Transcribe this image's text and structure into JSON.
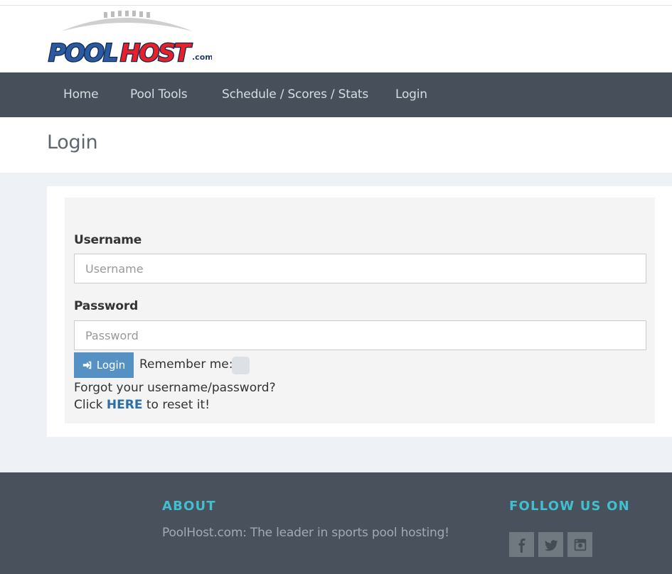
{
  "brand": {
    "logo_text_left": "POOL",
    "logo_text_right": "HOST",
    "logo_suffix": ".com",
    "colors": {
      "navy": "#1f3b6e",
      "red": "#e8202a",
      "gray_ball": "#c8c8c8"
    }
  },
  "nav": {
    "items": [
      {
        "label": "Home"
      },
      {
        "label": "Pool Tools"
      },
      {
        "label": "Schedule / Scores / Stats"
      },
      {
        "label": "Login"
      }
    ]
  },
  "page": {
    "title": "Login"
  },
  "form": {
    "username_label": "Username",
    "username_placeholder": "Username",
    "username_value": "",
    "password_label": "Password",
    "password_placeholder": "Password",
    "password_value": "",
    "login_button": "Login",
    "login_icon": "sign-in-icon",
    "remember_label": "Remember me:",
    "remember_checked": false,
    "forgot_text": "Forgot your username/password?",
    "reset_prefix": "Click ",
    "reset_link": "HERE",
    "reset_suffix": " to reset it!"
  },
  "footer": {
    "about_heading": "ABOUT",
    "about_text": "PoolHost.com: The leader in sports pool hosting!",
    "follow_heading": "FOLLOW US ON",
    "social": [
      {
        "icon": "facebook-icon"
      },
      {
        "icon": "twitter-icon"
      },
      {
        "icon": "instagram-icon"
      }
    ]
  },
  "colors": {
    "nav_bg": "#464f5a",
    "footer_bg": "#48515c",
    "accent_teal": "#3fbfcf",
    "button_blue": "#5592c3",
    "link_blue": "#2a6fa8"
  }
}
